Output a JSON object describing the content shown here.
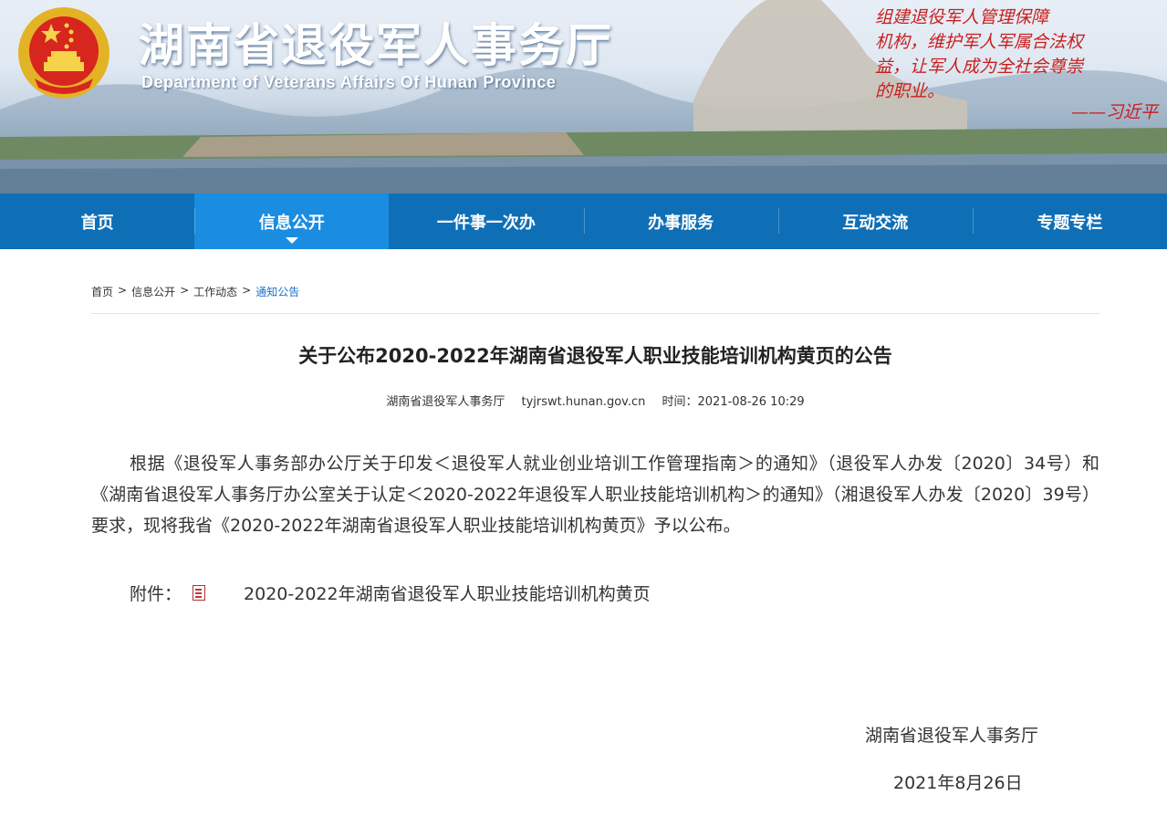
{
  "header": {
    "site_title": "湖南省退役军人事务厅",
    "site_subtitle": "Department of Veterans Affairs Of Hunan Province",
    "quote_lines": [
      "组建退役军人管理保障",
      "机构，维护军人军属合法权",
      "益，让军人成为全社会尊崇",
      "的职业。"
    ],
    "quote_signature": "——习近平"
  },
  "nav": {
    "items": [
      "首页",
      "信息公开",
      "一件事一次办",
      "办事服务",
      "互动交流",
      "专题专栏"
    ],
    "active_index": 1
  },
  "breadcrumb": {
    "items": [
      "首页",
      "信息公开",
      "工作动态",
      "通知公告"
    ],
    "separator": ">"
  },
  "article": {
    "title": "关于公布2020-2022年湖南省退役军人职业技能培训机构黄页的公告",
    "source": "湖南省退役军人事务厅",
    "site": "tyjrswt.hunan.gov.cn",
    "time": "时间：2021-08-26 10:29",
    "body": "根据《退役军人事务部办公厅关于印发＜退役军人就业创业培训工作管理指南＞的通知》（退役军人办发〔2020〕34号）和《湖南省退役军人事务厅办公室关于认定＜2020-2022年退役军人职业技能培训机构＞的通知》（湘退役军人办发〔2020〕39号）要求，现将我省《2020-2022年湖南省退役军人职业技能培训机构黄页》予以公布。",
    "attachment_label": "附件：",
    "attachment_name": "2020-2022年湖南省退役军人职业技能培训机构黄页",
    "signature_org": "湖南省退役军人事务厅",
    "signature_date": "2021年8月26日"
  },
  "colors": {
    "nav_bg": "#0f6fb6",
    "nav_active": "#1a8de0",
    "breadcrumb_current": "#1a73c8",
    "quote": "#c81f1f"
  }
}
